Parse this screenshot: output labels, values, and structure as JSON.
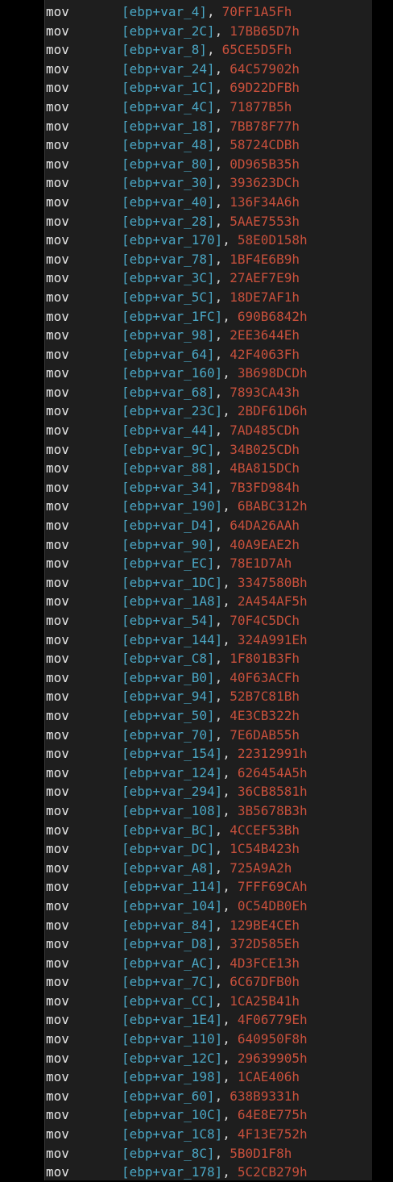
{
  "colors": {
    "background": "#1e1e1e",
    "gutter": "#000000",
    "mnemonic": "#e6e6e6",
    "bracket": "#4aa6c4",
    "register": "#4aa6c4",
    "variable": "#4aa6c4",
    "immediate": "#c8503c",
    "punctuation": "#dcdcdc"
  },
  "listing": [
    {
      "mnemonic": "mov",
      "reg": "ebp",
      "var": "var_4",
      "value": "70FF1A5Fh"
    },
    {
      "mnemonic": "mov",
      "reg": "ebp",
      "var": "var_2C",
      "value": "17BB65D7h"
    },
    {
      "mnemonic": "mov",
      "reg": "ebp",
      "var": "var_8",
      "value": "65CE5D5Fh"
    },
    {
      "mnemonic": "mov",
      "reg": "ebp",
      "var": "var_24",
      "value": "64C57902h"
    },
    {
      "mnemonic": "mov",
      "reg": "ebp",
      "var": "var_1C",
      "value": "69D22DFBh"
    },
    {
      "mnemonic": "mov",
      "reg": "ebp",
      "var": "var_4C",
      "value": "71877B5h"
    },
    {
      "mnemonic": "mov",
      "reg": "ebp",
      "var": "var_18",
      "value": "7BB78F77h"
    },
    {
      "mnemonic": "mov",
      "reg": "ebp",
      "var": "var_48",
      "value": "58724CDBh"
    },
    {
      "mnemonic": "mov",
      "reg": "ebp",
      "var": "var_80",
      "value": "0D965B35h"
    },
    {
      "mnemonic": "mov",
      "reg": "ebp",
      "var": "var_30",
      "value": "393623DCh"
    },
    {
      "mnemonic": "mov",
      "reg": "ebp",
      "var": "var_40",
      "value": "136F34A6h"
    },
    {
      "mnemonic": "mov",
      "reg": "ebp",
      "var": "var_28",
      "value": "5AAE7553h"
    },
    {
      "mnemonic": "mov",
      "reg": "ebp",
      "var": "var_170",
      "value": "58E0D158h"
    },
    {
      "mnemonic": "mov",
      "reg": "ebp",
      "var": "var_78",
      "value": "1BF4E6B9h"
    },
    {
      "mnemonic": "mov",
      "reg": "ebp",
      "var": "var_3C",
      "value": "27AEF7E9h"
    },
    {
      "mnemonic": "mov",
      "reg": "ebp",
      "var": "var_5C",
      "value": "18DE7AF1h"
    },
    {
      "mnemonic": "mov",
      "reg": "ebp",
      "var": "var_1FC",
      "value": "690B6842h"
    },
    {
      "mnemonic": "mov",
      "reg": "ebp",
      "var": "var_98",
      "value": "2EE3644Eh"
    },
    {
      "mnemonic": "mov",
      "reg": "ebp",
      "var": "var_64",
      "value": "42F4063Fh"
    },
    {
      "mnemonic": "mov",
      "reg": "ebp",
      "var": "var_160",
      "value": "3B698DCDh"
    },
    {
      "mnemonic": "mov",
      "reg": "ebp",
      "var": "var_68",
      "value": "7893CA43h"
    },
    {
      "mnemonic": "mov",
      "reg": "ebp",
      "var": "var_23C",
      "value": "2BDF61D6h"
    },
    {
      "mnemonic": "mov",
      "reg": "ebp",
      "var": "var_44",
      "value": "7AD485CDh"
    },
    {
      "mnemonic": "mov",
      "reg": "ebp",
      "var": "var_9C",
      "value": "34B025CDh"
    },
    {
      "mnemonic": "mov",
      "reg": "ebp",
      "var": "var_88",
      "value": "4BA815DCh"
    },
    {
      "mnemonic": "mov",
      "reg": "ebp",
      "var": "var_34",
      "value": "7B3FD984h"
    },
    {
      "mnemonic": "mov",
      "reg": "ebp",
      "var": "var_190",
      "value": "6BABC312h"
    },
    {
      "mnemonic": "mov",
      "reg": "ebp",
      "var": "var_D4",
      "value": "64DA26AAh"
    },
    {
      "mnemonic": "mov",
      "reg": "ebp",
      "var": "var_90",
      "value": "40A9EAE2h"
    },
    {
      "mnemonic": "mov",
      "reg": "ebp",
      "var": "var_EC",
      "value": "78E1D7Ah"
    },
    {
      "mnemonic": "mov",
      "reg": "ebp",
      "var": "var_1DC",
      "value": "3347580Bh"
    },
    {
      "mnemonic": "mov",
      "reg": "ebp",
      "var": "var_1A8",
      "value": "2A454AF5h"
    },
    {
      "mnemonic": "mov",
      "reg": "ebp",
      "var": "var_54",
      "value": "70F4C5DCh"
    },
    {
      "mnemonic": "mov",
      "reg": "ebp",
      "var": "var_144",
      "value": "324A991Eh"
    },
    {
      "mnemonic": "mov",
      "reg": "ebp",
      "var": "var_C8",
      "value": "1F801B3Fh"
    },
    {
      "mnemonic": "mov",
      "reg": "ebp",
      "var": "var_B0",
      "value": "40F63ACFh"
    },
    {
      "mnemonic": "mov",
      "reg": "ebp",
      "var": "var_94",
      "value": "52B7C81Bh"
    },
    {
      "mnemonic": "mov",
      "reg": "ebp",
      "var": "var_50",
      "value": "4E3CB322h"
    },
    {
      "mnemonic": "mov",
      "reg": "ebp",
      "var": "var_70",
      "value": "7E6DAB55h"
    },
    {
      "mnemonic": "mov",
      "reg": "ebp",
      "var": "var_154",
      "value": "22312991h"
    },
    {
      "mnemonic": "mov",
      "reg": "ebp",
      "var": "var_124",
      "value": "626454A5h"
    },
    {
      "mnemonic": "mov",
      "reg": "ebp",
      "var": "var_294",
      "value": "36CB8581h"
    },
    {
      "mnemonic": "mov",
      "reg": "ebp",
      "var": "var_108",
      "value": "3B5678B3h"
    },
    {
      "mnemonic": "mov",
      "reg": "ebp",
      "var": "var_BC",
      "value": "4CCEF53Bh"
    },
    {
      "mnemonic": "mov",
      "reg": "ebp",
      "var": "var_DC",
      "value": "1C54B423h"
    },
    {
      "mnemonic": "mov",
      "reg": "ebp",
      "var": "var_A8",
      "value": "725A9A2h"
    },
    {
      "mnemonic": "mov",
      "reg": "ebp",
      "var": "var_114",
      "value": "7FFF69CAh"
    },
    {
      "mnemonic": "mov",
      "reg": "ebp",
      "var": "var_104",
      "value": "0C54DB0Eh"
    },
    {
      "mnemonic": "mov",
      "reg": "ebp",
      "var": "var_84",
      "value": "129BE4CEh"
    },
    {
      "mnemonic": "mov",
      "reg": "ebp",
      "var": "var_D8",
      "value": "372D585Eh"
    },
    {
      "mnemonic": "mov",
      "reg": "ebp",
      "var": "var_AC",
      "value": "4D3FCE13h"
    },
    {
      "mnemonic": "mov",
      "reg": "ebp",
      "var": "var_7C",
      "value": "6C67DFB0h"
    },
    {
      "mnemonic": "mov",
      "reg": "ebp",
      "var": "var_CC",
      "value": "1CA25B41h"
    },
    {
      "mnemonic": "mov",
      "reg": "ebp",
      "var": "var_1E4",
      "value": "4F06779Eh"
    },
    {
      "mnemonic": "mov",
      "reg": "ebp",
      "var": "var_110",
      "value": "640950F8h"
    },
    {
      "mnemonic": "mov",
      "reg": "ebp",
      "var": "var_12C",
      "value": "29639905h"
    },
    {
      "mnemonic": "mov",
      "reg": "ebp",
      "var": "var_198",
      "value": "1CAE406h"
    },
    {
      "mnemonic": "mov",
      "reg": "ebp",
      "var": "var_60",
      "value": "638B9331h"
    },
    {
      "mnemonic": "mov",
      "reg": "ebp",
      "var": "var_10C",
      "value": "64E8E775h"
    },
    {
      "mnemonic": "mov",
      "reg": "ebp",
      "var": "var_1C8",
      "value": "4F13E752h"
    },
    {
      "mnemonic": "mov",
      "reg": "ebp",
      "var": "var_8C",
      "value": "5B0D1F8h"
    },
    {
      "mnemonic": "mov",
      "reg": "ebp",
      "var": "var_178",
      "value": "5C2CB279h"
    }
  ]
}
